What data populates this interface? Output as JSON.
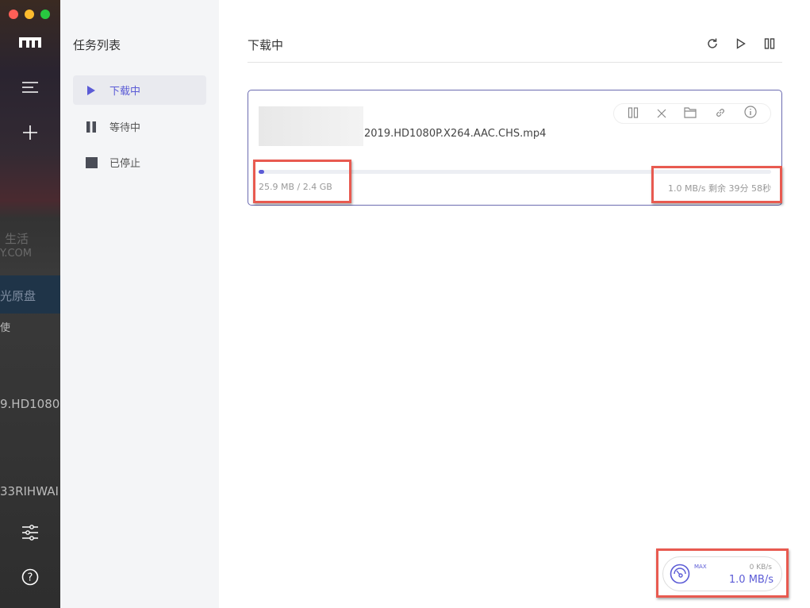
{
  "background_fragments": [
    "生活",
    "Y.COM",
    "光原盘",
    "使",
    "9.HD1080",
    "33RIHWAI"
  ],
  "sidebar": {
    "icons": [
      "logo-icon",
      "menu-icon",
      "plus-icon",
      "sliders-icon",
      "help-icon"
    ]
  },
  "panel": {
    "title": "任务列表",
    "items": [
      {
        "label": "下载中",
        "icon": "play-icon",
        "active": true
      },
      {
        "label": "等待中",
        "icon": "pause-icon"
      },
      {
        "label": "已停止",
        "icon": "stop-icon"
      }
    ]
  },
  "main": {
    "title": "下载中",
    "toolbar": [
      "refresh-icon",
      "play-icon",
      "pause-icon"
    ]
  },
  "task": {
    "filename": "2019.HD1080P.X264.AAC.CHS.mp4",
    "progress_percent": 1.05,
    "size": "25.9 MB / 2.4 GB",
    "status": "1.0 MB/s 剩余 39分 58秒",
    "actions": [
      "pause-icon",
      "close-icon",
      "folder-icon",
      "link-icon",
      "info-icon"
    ]
  },
  "speedometer": {
    "label": "MAX",
    "upload": "0 KB/s",
    "download": "1.0 MB/s"
  },
  "colors": {
    "accent": "#5b5bd6",
    "highlight": "#e85a50"
  }
}
